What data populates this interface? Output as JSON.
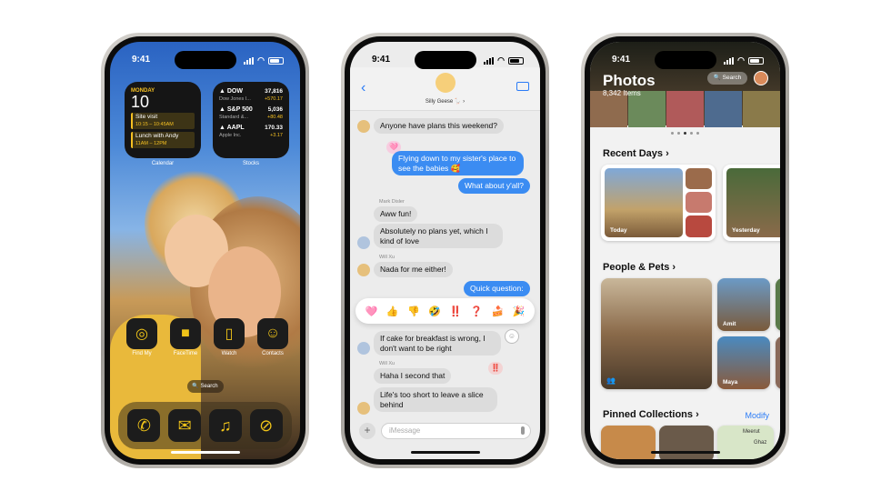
{
  "phone1": {
    "time": "9:41",
    "calendar": {
      "day": "MONDAY",
      "date": "10",
      "events": [
        {
          "title": "Site visit",
          "time": "10:15 – 10:45AM"
        },
        {
          "title": "Lunch with Andy",
          "time": "11AM – 12PM"
        }
      ],
      "label": "Calendar"
    },
    "stocks": {
      "items": [
        {
          "symbol": "▲ DOW",
          "name": "Dow Jones I...",
          "price": "37,816",
          "change": "+570.17"
        },
        {
          "symbol": "▲ S&P 500",
          "name": "Standard &...",
          "price": "5,036",
          "change": "+80.48"
        },
        {
          "symbol": "▲ AAPL",
          "name": "Apple Inc.",
          "price": "170.33",
          "change": "+3.17"
        }
      ],
      "label": "Stocks"
    },
    "apps": [
      {
        "label": "Find My",
        "icon": "find-my-icon",
        "glyph": "◎"
      },
      {
        "label": "FaceTime",
        "icon": "facetime-icon",
        "glyph": "■"
      },
      {
        "label": "Watch",
        "icon": "watch-icon",
        "glyph": "▯"
      },
      {
        "label": "Contacts",
        "icon": "contacts-icon",
        "glyph": "☺"
      }
    ],
    "search": "🔍 Search",
    "dock": [
      {
        "icon": "phone-icon",
        "glyph": "✆"
      },
      {
        "icon": "mail-icon",
        "glyph": "✉"
      },
      {
        "icon": "music-icon",
        "glyph": "♫"
      },
      {
        "icon": "safari-icon",
        "glyph": "⊘"
      }
    ]
  },
  "phone2": {
    "time": "9:41",
    "group_name": "Silly Geese 🪿 ›",
    "messages": [
      {
        "text": "Anyone have plans this weekend?"
      },
      {
        "text": "Flying down to my sister's place to see the babies 🥰"
      },
      {
        "text": "What about y'all?"
      },
      {
        "sender": "Mark Disler"
      },
      {
        "text": "Aww fun!"
      },
      {
        "text": "Absolutely no plans yet, which I kind of love"
      },
      {
        "sender": "Will Xu"
      },
      {
        "text": "Nada for me either!"
      },
      {
        "text": "Quick question:"
      },
      {
        "text": "If cake for breakfast is wrong, I don't want to be right"
      },
      {
        "sender": "Will Xu"
      },
      {
        "text": "Haha I second that"
      },
      {
        "text": "Life's too short to leave a slice behind"
      }
    ],
    "tapbacks": [
      "🩷",
      "👍",
      "👎",
      "🤣",
      "‼️",
      "❓",
      "🍰",
      "🎉"
    ],
    "input_placeholder": "iMessage"
  },
  "phone3": {
    "time": "9:41",
    "title": "Photos",
    "count": "8,342 Items",
    "search": "🔍 Search",
    "recent_days": "Recent Days ›",
    "today": "Today",
    "yesterday": "Yesterday",
    "people_pets": "People & Pets ›",
    "people": [
      "Amit",
      "Maya"
    ],
    "pinned": "Pinned Collections ›",
    "modify": "Modify",
    "map_labels": [
      "Meerut",
      "Ghaz"
    ]
  }
}
